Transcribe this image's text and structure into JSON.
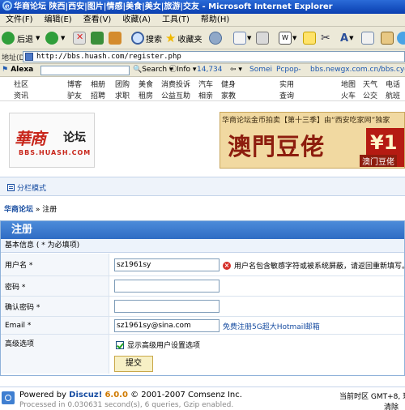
{
  "window": {
    "title": "华商论坛 陕西|西安|图片|情感|美食|美女|旅游|交友 - Microsoft Internet Explorer"
  },
  "menu": [
    "文件(F)",
    "编辑(E)",
    "查看(V)",
    "收藏(A)",
    "工具(T)",
    "帮助(H)"
  ],
  "toolbar": {
    "back_label": "后退",
    "search_label": "搜索",
    "favorites_label": "收藏夹"
  },
  "address": {
    "label": "地址(D)",
    "url": "http://bbs.huash.com/register.php"
  },
  "alexa": {
    "brand": "Alexa",
    "search_label": "Search",
    "info_label": "Info",
    "rank": "14,734",
    "links": [
      "Somei",
      "Pcpop-",
      "bbs.newgx.com.cn/",
      "bbs.cyo"
    ]
  },
  "sitenav": {
    "row1": [
      "社区",
      "博客",
      "相册",
      "团购",
      "美食",
      "消费投诉",
      "汽车",
      "健身",
      "实用",
      "地图",
      "天气",
      "电话"
    ],
    "row2": [
      "资讯",
      "驴友",
      "招聘",
      "求职",
      "租房",
      "公益互助",
      "相亲",
      "家教",
      "查询",
      "火车",
      "公交",
      "航班"
    ]
  },
  "logo": {
    "mark": "華商",
    "lun": "论坛",
    "url": "BBS.HUASH.COM"
  },
  "banner": {
    "top": "华商论坛金币拍卖【第十三季】由“西安吃家网”独家",
    "big": "澳門豆佬",
    "price": "¥1",
    "sub": "澳门豆佬"
  },
  "mode": {
    "label": "分栏模式"
  },
  "breadcrumb": {
    "home": "华商论坛",
    "current": "注册"
  },
  "form": {
    "title": "注册",
    "subtitle": "基本信息 ( * 为必填项)",
    "username_label": "用户名 *",
    "username_value": "sz1961sy",
    "username_error": "用户名包含敏感字符或被系统屏蔽，请返回重新填写。",
    "password_label": "密码 *",
    "confirm_label": "确认密码 *",
    "email_label": "Email *",
    "email_value": "sz1961sy@sina.com",
    "email_link": "免费注册5G超大Hotmail邮箱",
    "advanced_label": "高级选项",
    "advanced_checkbox": "显示高级用户设置选项",
    "submit_label": "提交"
  },
  "footer": {
    "powered_prefix": "Powered by",
    "brand": "Discuz!",
    "version": "6.0.0",
    "copyright": "© 2001-2007 Comsenz Inc.",
    "processed": "Processed in 0.030631 second(s), 6 queries, Gzip enabled.",
    "timezone": "当前时区 GMT+8, 现",
    "clear": "清除"
  }
}
